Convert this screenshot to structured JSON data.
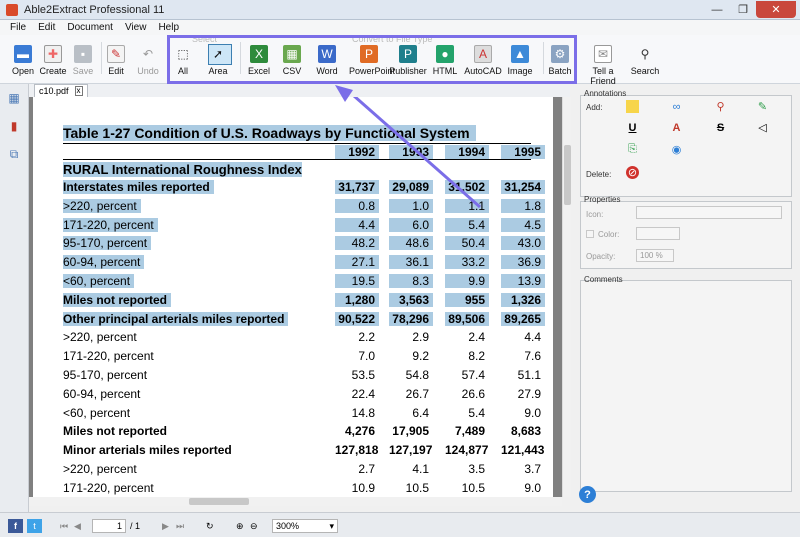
{
  "window": {
    "title": "Able2Extract Professional 11",
    "min": "—",
    "max": "❐",
    "close": "✕"
  },
  "menu": [
    "File",
    "Edit",
    "Document",
    "View",
    "Help"
  ],
  "toolbar": {
    "open": "Open",
    "create": "Create",
    "save": "Save",
    "edit": "Edit",
    "undo": "Undo",
    "select_group": "Select",
    "all": "All",
    "area": "Area",
    "convert_group": "Convert to File Type",
    "excel": "Excel",
    "csv": "CSV",
    "word": "Word",
    "powerpoint": "PowerPoint",
    "publisher": "Publisher",
    "html": "HTML",
    "autocad": "AutoCAD",
    "image": "Image",
    "batch": "Batch",
    "tell": "Tell a Friend",
    "search": "Search"
  },
  "tab": {
    "name": "c10.pdf",
    "close": "x"
  },
  "document": {
    "title": "Table 1-27  Condition of U.S. Roadways by Functional System",
    "years": [
      "1992",
      "1993",
      "1994",
      "1995"
    ],
    "section": "RURAL International Roughness Index",
    "rows": [
      {
        "label": "Interstates miles reported",
        "v": [
          "31,737",
          "29,089",
          "31,502",
          "31,254"
        ],
        "bold": true,
        "hl": true
      },
      {
        "label": ">220, percent",
        "v": [
          "0.8",
          "1.0",
          "1.1",
          "1.8"
        ],
        "bold": false,
        "hl": true
      },
      {
        "label": "171-220, percent",
        "v": [
          "4.4",
          "6.0",
          "5.4",
          "4.5"
        ],
        "bold": false,
        "hl": true
      },
      {
        "label": "95-170, percent",
        "v": [
          "48.2",
          "48.6",
          "50.4",
          "43.0"
        ],
        "bold": false,
        "hl": true
      },
      {
        "label": "60-94, percent",
        "v": [
          "27.1",
          "36.1",
          "33.2",
          "36.9"
        ],
        "bold": false,
        "hl": true
      },
      {
        "label": "<60, percent",
        "v": [
          "19.5",
          "8.3",
          "9.9",
          "13.9"
        ],
        "bold": false,
        "hl": true
      },
      {
        "label": "Miles not reported",
        "v": [
          "1,280",
          "3,563",
          "955",
          "1,326"
        ],
        "bold": true,
        "hl": true
      },
      {
        "label": "Other principal arterials miles reported",
        "v": [
          "90,522",
          "78,296",
          "89,506",
          "89,265"
        ],
        "bold": true,
        "hl": true
      },
      {
        "label": ">220, percent",
        "v": [
          "2.2",
          "2.9",
          "2.4",
          "4.4"
        ],
        "bold": false,
        "hl": false
      },
      {
        "label": "171-220, percent",
        "v": [
          "7.0",
          "9.2",
          "8.2",
          "7.6"
        ],
        "bold": false,
        "hl": false
      },
      {
        "label": "95-170, percent",
        "v": [
          "53.5",
          "54.8",
          "57.4",
          "51.1"
        ],
        "bold": false,
        "hl": false
      },
      {
        "label": "60-94, percent",
        "v": [
          "22.4",
          "26.7",
          "26.6",
          "27.9"
        ],
        "bold": false,
        "hl": false
      },
      {
        "label": "<60, percent",
        "v": [
          "14.8",
          "6.4",
          "5.4",
          "9.0"
        ],
        "bold": false,
        "hl": false
      },
      {
        "label": "Miles not reported",
        "v": [
          "4,276",
          "17,905",
          "7,489",
          "8,683"
        ],
        "bold": true,
        "hl": false
      },
      {
        "label": "Minor arterials miles reported",
        "v": [
          "127,818",
          "127,197",
          "124,877",
          "121,443"
        ],
        "bold": true,
        "hl": false
      },
      {
        "label": ">220, percent",
        "v": [
          "2.7",
          "4.1",
          "3.5",
          "3.7"
        ],
        "bold": false,
        "hl": false
      },
      {
        "label": "171-220, percent",
        "v": [
          "10.9",
          "10.5",
          "10.5",
          "9.0"
        ],
        "bold": false,
        "hl": false
      }
    ]
  },
  "panel": {
    "annotations": "Annotations",
    "add": "Add:",
    "delete": "Delete:",
    "properties": "Properties",
    "icon": "Icon:",
    "color": "Color:",
    "opacity": "Opacity:",
    "opacity_value": "100 %",
    "comments": "Comments"
  },
  "status": {
    "page": "1",
    "total": "/ 1",
    "zoom": "300%",
    "fb": "f",
    "tw": "t"
  },
  "colors": {
    "highlight": "#abcbe2",
    "callout": "#7b6ee8"
  }
}
